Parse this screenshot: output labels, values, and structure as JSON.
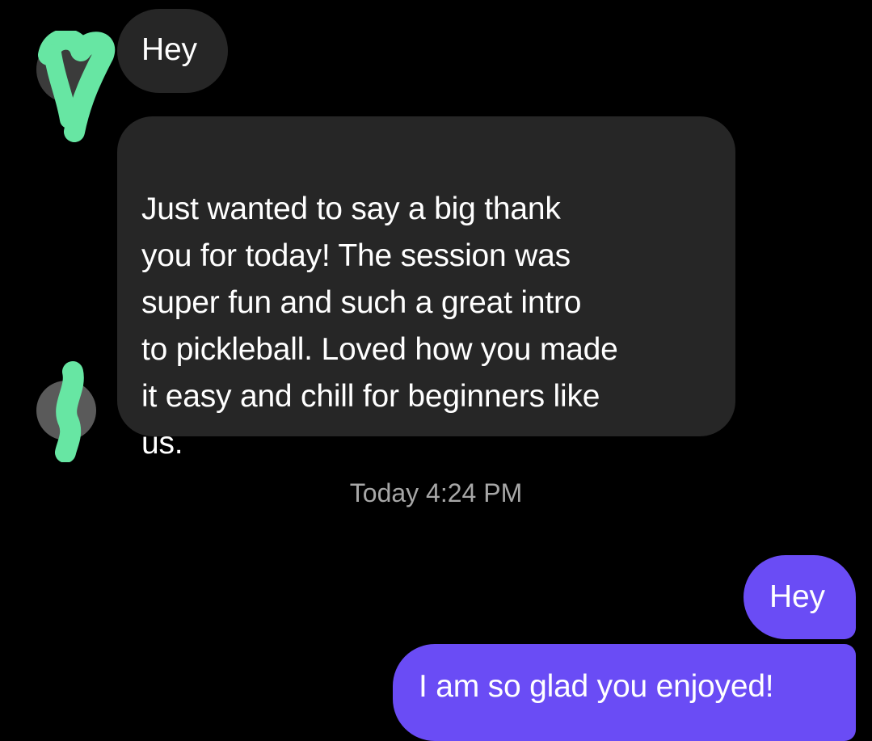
{
  "conversation": {
    "messages": [
      {
        "sender": "other",
        "text": "Hey"
      },
      {
        "sender": "other",
        "text": "Just wanted to say a big thank\nyou for today! The session was\nsuper fun and such a great intro\nto pickleball. Loved how you made\nit easy and chill for beginners like\nus."
      },
      {
        "sender": "me",
        "text": "Hey"
      },
      {
        "sender": "me",
        "text": "I am so glad you enjoyed!"
      }
    ],
    "timestamp": "Today 4:24 PM"
  },
  "colors": {
    "background": "#000000",
    "incoming_bubble": "#262626",
    "outgoing_bubble": "#6a4cf5",
    "redaction": "#67e6a3",
    "timestamp_text": "#a7a7a7"
  },
  "icons": {
    "avatar_top": "avatar-redacted",
    "avatar_bottom": "avatar-redacted"
  }
}
